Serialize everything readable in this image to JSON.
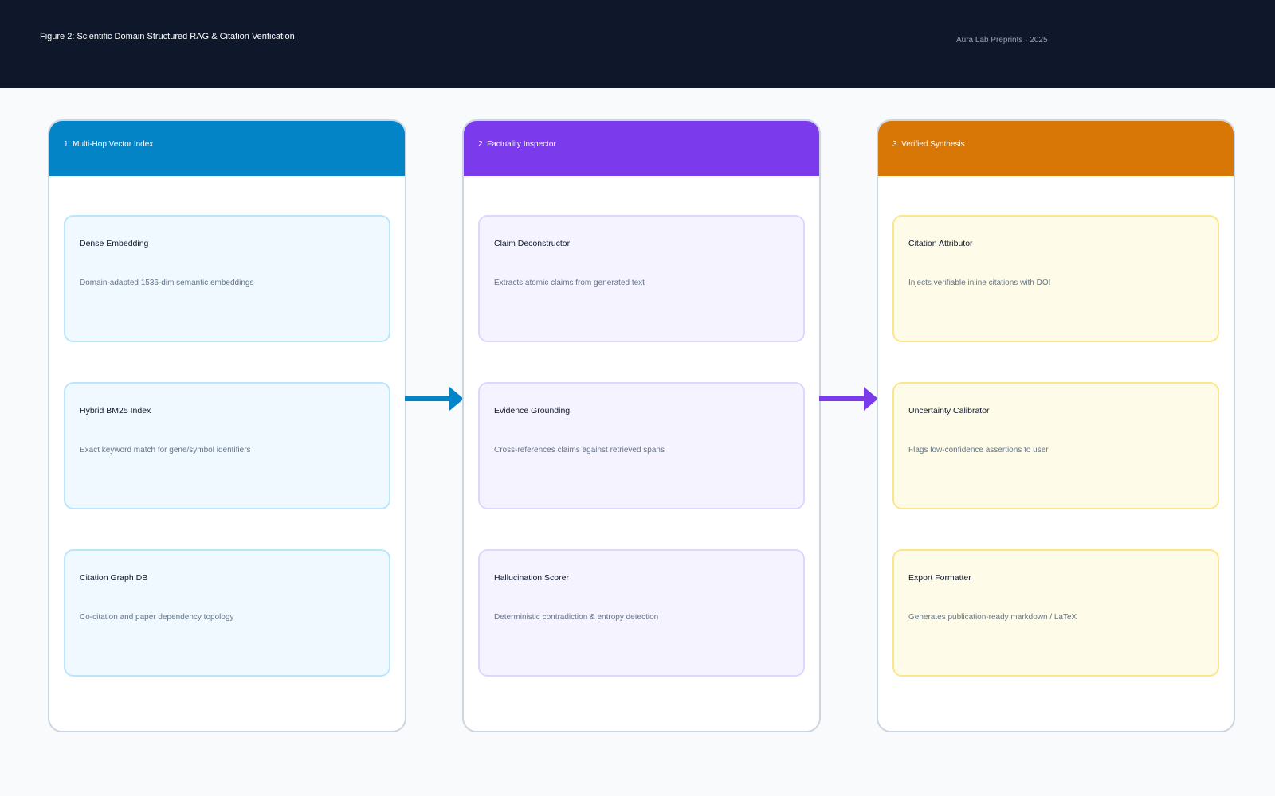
{
  "header": {
    "title": "Figure 2: Scientific Domain Structured RAG & Citation Verification",
    "meta": "Aura Lab Preprints · 2025"
  },
  "columns": [
    {
      "title": "1. Multi-Hop Vector Index",
      "color": "#0284c7",
      "cards": [
        {
          "title": "Dense Embedding",
          "desc": "Domain-adapted 1536-dim semantic embeddings"
        },
        {
          "title": "Hybrid BM25 Index",
          "desc": "Exact keyword match for gene/symbol identifiers"
        },
        {
          "title": "Citation Graph DB",
          "desc": "Co-citation and paper dependency topology"
        }
      ]
    },
    {
      "title": "2. Factuality Inspector",
      "color": "#7c3aed",
      "cards": [
        {
          "title": "Claim Deconstructor",
          "desc": "Extracts atomic claims from generated text"
        },
        {
          "title": "Evidence Grounding",
          "desc": "Cross-references claims against retrieved spans"
        },
        {
          "title": "Hallucination Scorer",
          "desc": "Deterministic contradiction & entropy detection"
        }
      ]
    },
    {
      "title": "3. Verified Synthesis",
      "color": "#d97706",
      "cards": [
        {
          "title": "Citation Attributor",
          "desc": "Injects verifiable inline citations with DOI"
        },
        {
          "title": "Uncertainty Calibrator",
          "desc": "Flags low-confidence assertions to user"
        },
        {
          "title": "Export Formatter",
          "desc": "Generates publication-ready markdown / LaTeX"
        }
      ]
    }
  ],
  "arrows": [
    {
      "color": "#0284c7"
    },
    {
      "color": "#7c3aed"
    }
  ]
}
